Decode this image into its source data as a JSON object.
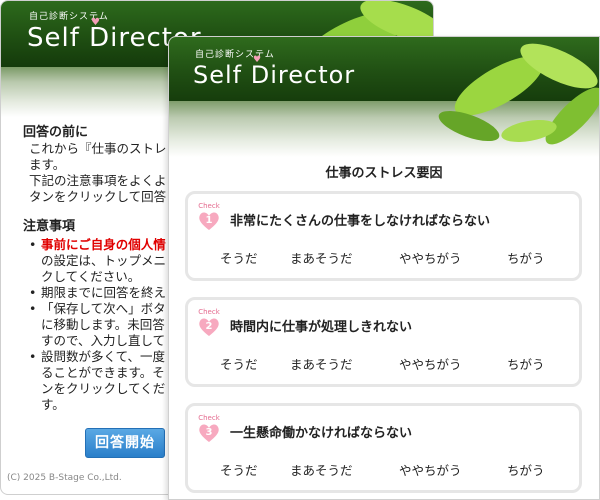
{
  "brand": {
    "subtitle": "自己診断システム",
    "name_prefix": "Self D",
    "name_suffix": "irector"
  },
  "back_window": {
    "section1_heading": "回答の前に",
    "intro_lines": [
      "これから『仕事のストレ",
      "ます。",
      "下記の注意事項をよくよ",
      "タンをクリックして回答"
    ],
    "notes_heading": "注意事項",
    "notes": [
      {
        "red": "事前にご自身の個人情",
        "lines": [
          "の設定は、トップメニ",
          "クしてください。"
        ]
      },
      {
        "red": "",
        "lines": [
          "期限までに回答を終え"
        ]
      },
      {
        "red": "",
        "lines": [
          "「保存して次へ」ボタ",
          "に移動します。未回答",
          "すので、入力し直して"
        ]
      },
      {
        "red": "",
        "lines": [
          "設問数が多くて、一度",
          "ることができます。そ",
          "ンをクリックしてくだ",
          "す。"
        ]
      }
    ],
    "start_button": "回答開始",
    "copyright": "(C) 2025 B-Stage Co.,Ltd."
  },
  "front_window": {
    "page_title": "仕事のストレス要因",
    "check_label": "Check",
    "options": [
      "そうだ",
      "まあそうだ",
      "ややちがう",
      "ちがう"
    ],
    "questions": [
      {
        "number": "1",
        "text": "非常にたくさんの仕事をしなければならない"
      },
      {
        "number": "2",
        "text": "時間内に仕事が処理しきれない"
      },
      {
        "number": "3",
        "text": "一生懸命働かなければならない"
      }
    ]
  },
  "colors": {
    "header_green": "#1f4f12",
    "accent_pink": "#f4a0b8",
    "warning_red": "#e00000",
    "button_blue": "#2a7fca"
  }
}
